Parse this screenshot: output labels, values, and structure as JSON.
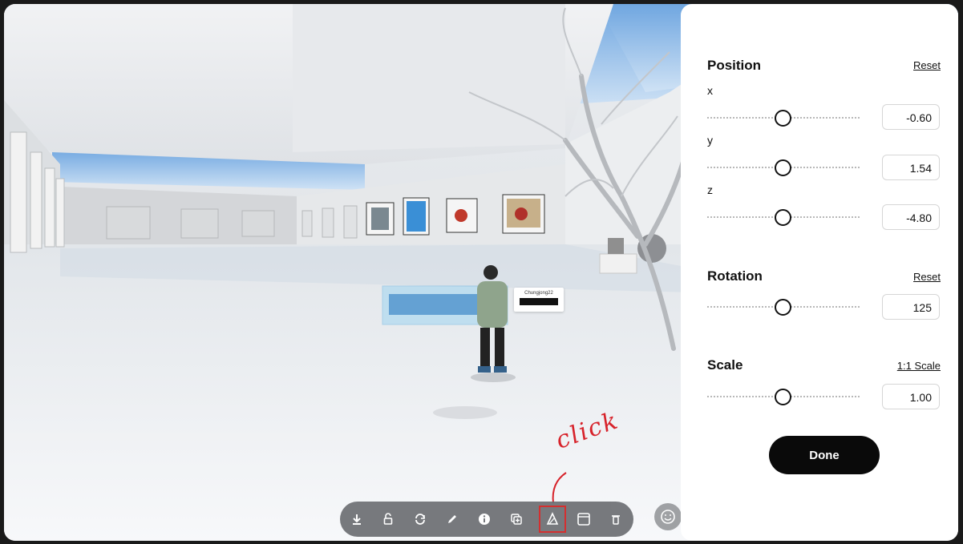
{
  "scene": {
    "nametag_name": "Chungjong22",
    "annotation": "click"
  },
  "toolbar": {
    "items": [
      {
        "name": "download"
      },
      {
        "name": "lock"
      },
      {
        "name": "rotate"
      },
      {
        "name": "edit"
      },
      {
        "name": "info"
      },
      {
        "name": "duplicate"
      },
      {
        "name": "transform",
        "active": true
      },
      {
        "name": "frame"
      },
      {
        "name": "delete"
      }
    ]
  },
  "panel": {
    "position": {
      "title": "Position",
      "reset": "Reset",
      "x": {
        "label": "x",
        "value": "-0.60"
      },
      "y": {
        "label": "y",
        "value": "1.54"
      },
      "z": {
        "label": "z",
        "value": "-4.80"
      }
    },
    "rotation": {
      "title": "Rotation",
      "reset": "Reset",
      "value": "125"
    },
    "scale": {
      "title": "Scale",
      "reset": "1:1 Scale",
      "value": "1.00"
    },
    "done_label": "Done"
  },
  "colors": {
    "accent": "#000000",
    "annotation": "#d7232b",
    "toolbar_bg": "#6d6f73",
    "sky": "#7fb1e3"
  }
}
